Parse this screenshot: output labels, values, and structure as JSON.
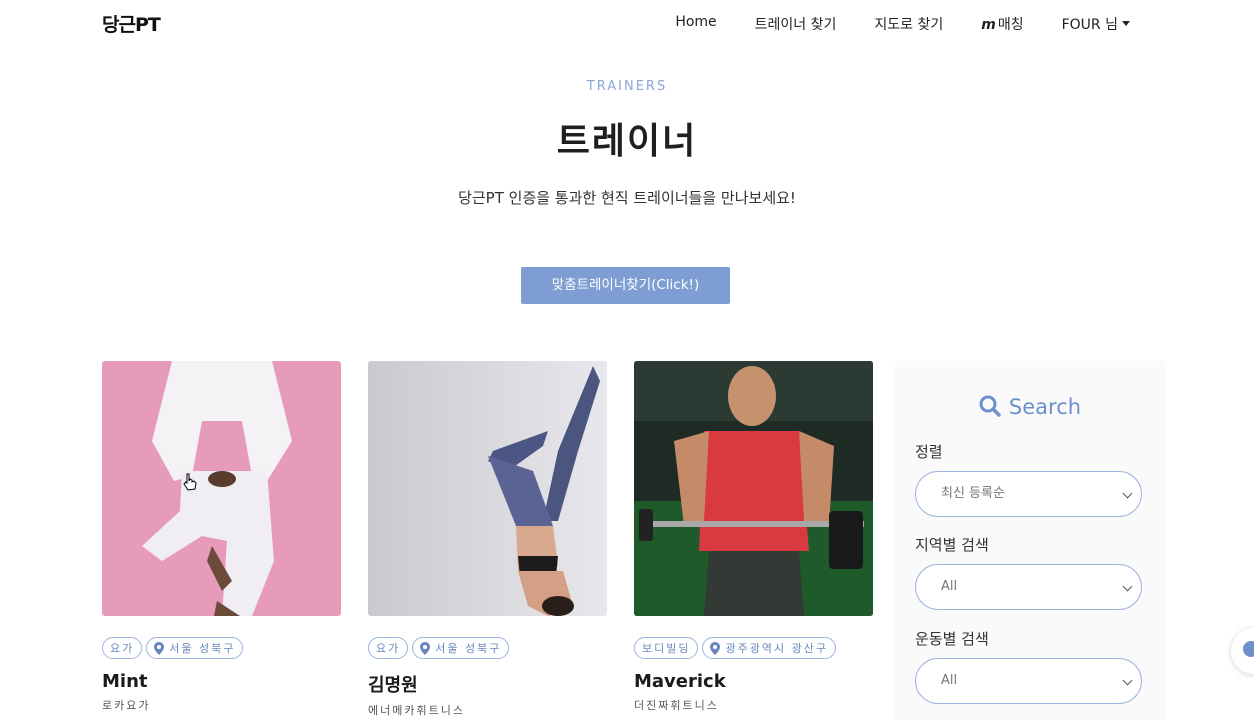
{
  "nav": {
    "logo": "당근PT",
    "items": [
      "Home",
      "트레이너 찾기",
      "지도로 찾기"
    ],
    "matching_icon": "m",
    "matching_label": "매칭",
    "user_label": "FOUR 님"
  },
  "hero": {
    "eyebrow": "TRAINERS",
    "title": "트레이너",
    "subtitle": "당근PT 인증을 통과한 현직 트레이너들을 만나보세요!",
    "cta_label": "맞춤트레이너찾기(Click!)"
  },
  "trainers": [
    {
      "category": "요가",
      "location": "서울 성북구",
      "name": "Mint",
      "gym": "로카요가"
    },
    {
      "category": "요가",
      "location": "서울 성북구",
      "name": "김명원",
      "gym": "에너메카휘트니스"
    },
    {
      "category": "보디빌딩",
      "location": "광주광역시 광산구",
      "name": "Maverick",
      "gym": "더진짜휘트니스"
    }
  ],
  "search": {
    "title": "Search",
    "sort_label": "정렬",
    "sort_value": "최신 등록순",
    "region_label": "지역별 검색",
    "region_value": "All",
    "exercise_label": "운동별 검색",
    "exercise_value": "All"
  },
  "colors": {
    "accent": "#7e9ed3",
    "accent_text": "#6d8fcc",
    "tag_border": "#9bb3dd"
  }
}
